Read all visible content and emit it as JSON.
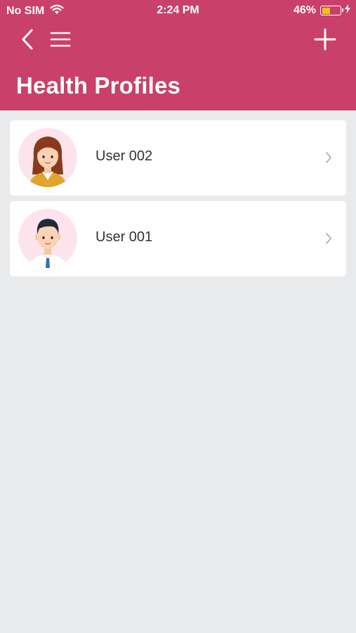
{
  "status_bar": {
    "carrier": "No SIM",
    "time": "2:24 PM",
    "battery_percent": "46%",
    "battery_level": 0.46
  },
  "nav": {
    "back_icon": "chevron-left-icon",
    "menu_icon": "hamburger-menu-icon",
    "add_icon": "plus-icon"
  },
  "page": {
    "title": "Health Profiles"
  },
  "profiles": [
    {
      "name": "User 002",
      "avatar": "female-avatar"
    },
    {
      "name": "User 001",
      "avatar": "male-avatar"
    }
  ],
  "colors": {
    "header": "#c9406b",
    "background": "#e9eaec",
    "card": "#ffffff",
    "avatar_bg": "#fde4ec",
    "battery": "#f4c20d"
  }
}
